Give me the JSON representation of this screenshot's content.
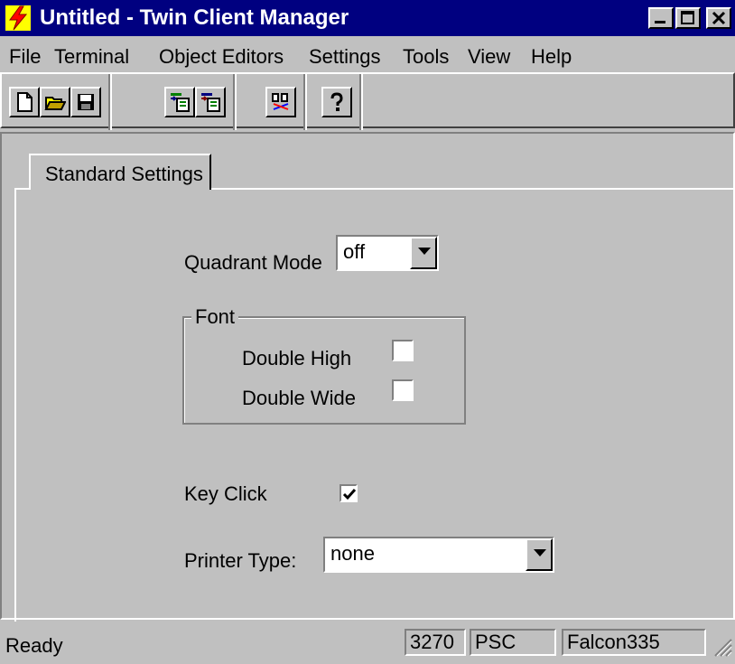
{
  "window": {
    "title": "Untitled - Twin Client Manager",
    "controls": [
      "minimize-icon",
      "maximize-icon",
      "close-icon"
    ]
  },
  "menu": {
    "items": [
      {
        "label": "File"
      },
      {
        "label": "Terminal"
      },
      {
        "label": "Object Editors"
      },
      {
        "label": "Settings"
      },
      {
        "label": "Tools"
      },
      {
        "label": "View"
      },
      {
        "label": "Help"
      }
    ]
  },
  "toolbar": {
    "buttons": [
      "new-file-icon",
      "open-folder-icon",
      "save-icon",
      "import-icon",
      "export-icon",
      "compare-icon",
      "help-icon"
    ]
  },
  "tab": {
    "label": "Standard Settings"
  },
  "settings": {
    "quadrant_mode_label": "Quadrant Mode",
    "quadrant_mode_value": "off",
    "font_group_label": "Font",
    "double_high_label": "Double High",
    "double_high_checked": false,
    "double_wide_label": "Double Wide",
    "double_wide_checked": false,
    "key_click_label": "Key Click",
    "key_click_checked": true,
    "printer_type_label": "Printer Type:",
    "printer_type_value": "none"
  },
  "status": {
    "ready": "Ready",
    "terminal": "3270",
    "mode": "PSC",
    "host": "Falcon335"
  },
  "colors": {
    "title_bar": "#000080",
    "face": "#c0c0c0",
    "icon_lightning": "#ff0000",
    "icon_bg": "#ffff00"
  }
}
